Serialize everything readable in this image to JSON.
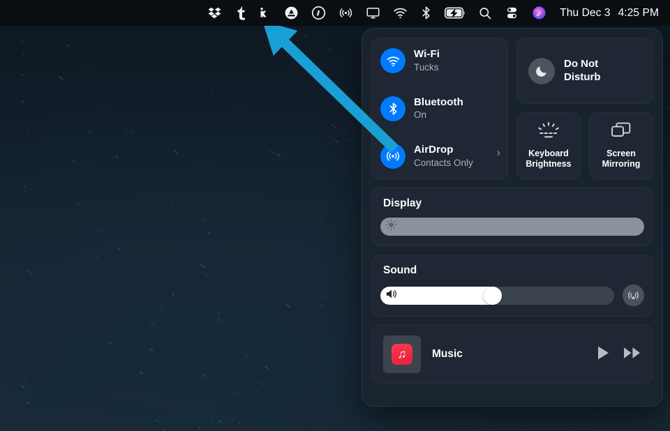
{
  "menubar": {
    "icons": [
      {
        "name": "dropbox-icon",
        "label": "Dropbox"
      },
      {
        "name": "tumblr-icon",
        "label": "Tumblr"
      },
      {
        "name": "kap-icon",
        "label": "Kap"
      },
      {
        "name": "arc-icon",
        "label": "Arc"
      },
      {
        "name": "onepassword-icon",
        "label": "1Password"
      },
      {
        "name": "airdrop-icon",
        "label": "AirDrop"
      },
      {
        "name": "display-icon",
        "label": "Display"
      },
      {
        "name": "wifi-icon",
        "label": "Wi-Fi"
      },
      {
        "name": "bluetooth-icon",
        "label": "Bluetooth"
      },
      {
        "name": "battery-charging-icon",
        "label": "Battery Charging"
      },
      {
        "name": "search-icon",
        "label": "Spotlight Search"
      },
      {
        "name": "control-center-icon",
        "label": "Control Center"
      },
      {
        "name": "siri-icon",
        "label": "Siri"
      }
    ],
    "day": "Thu Dec 3",
    "time": "4:25 PM"
  },
  "control_center": {
    "connectivity": [
      {
        "title": "Wi-Fi",
        "subtitle": "Tucks",
        "icon": "wifi-icon",
        "active": true,
        "chevron": false
      },
      {
        "title": "Bluetooth",
        "subtitle": "On",
        "icon": "bluetooth-icon",
        "active": true,
        "chevron": false
      },
      {
        "title": "AirDrop",
        "subtitle": "Contacts Only",
        "icon": "airdrop-icon",
        "active": true,
        "chevron": true
      }
    ],
    "do_not_disturb": {
      "label_line1": "Do Not",
      "label_line2": "Disturb",
      "icon": "moon-icon",
      "active": false
    },
    "tiles": [
      {
        "label_line1": "Keyboard",
        "label_line2": "Brightness",
        "icon": "keyboard-brightness-icon"
      },
      {
        "label_line1": "Screen",
        "label_line2": "Mirroring",
        "icon": "screen-mirroring-icon"
      }
    ],
    "display": {
      "title": "Display",
      "icon": "brightness-icon",
      "value": 100
    },
    "sound": {
      "title": "Sound",
      "icon": "volume-icon",
      "value": 48,
      "airplay_icon": "airplay-audio-icon"
    },
    "music": {
      "name": "Music",
      "app_icon": "music-note-icon",
      "play_icon": "play-icon",
      "next_icon": "fast-forward-icon"
    }
  },
  "annotation": {
    "arrow_color": "#1a9fd4",
    "points_to": "airdrop-icon"
  },
  "colors": {
    "accent": "#007aff",
    "panel": "#1a242f",
    "card": "#1e2733",
    "music_icon": "#fb3b53"
  }
}
